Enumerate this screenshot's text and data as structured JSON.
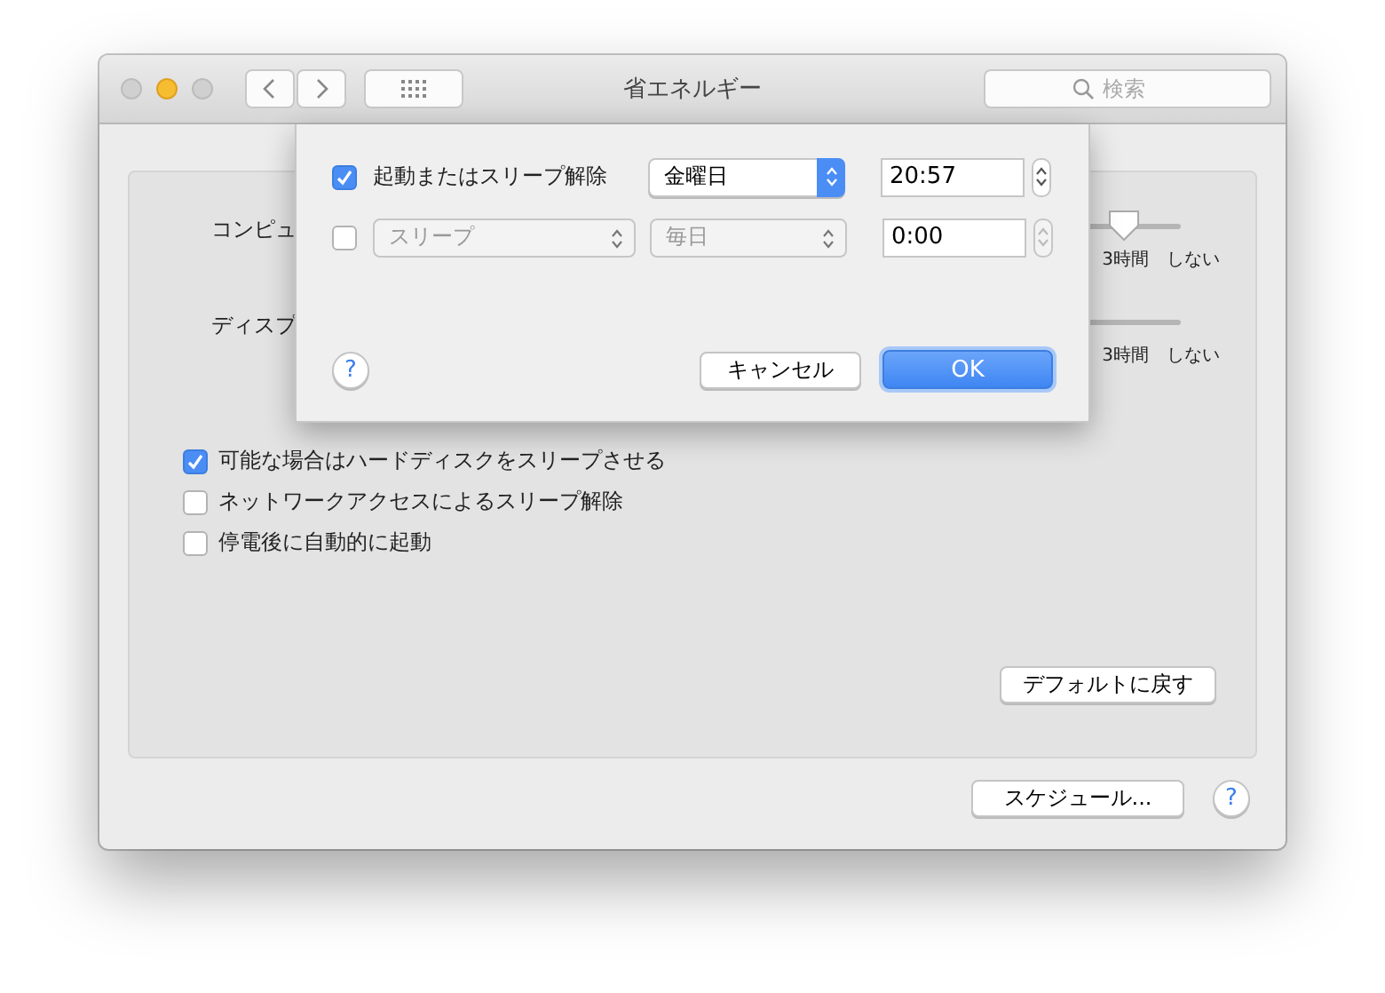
{
  "window": {
    "title": "省エネルギー",
    "search": {
      "placeholder": "検索"
    }
  },
  "settings": [
    {
      "label": "コンピュ",
      "level": 0.93,
      "ticks": [
        "3時間",
        "しない"
      ]
    },
    {
      "label": "ディスプ",
      "ticks": [
        "3時間",
        "しない"
      ]
    }
  ],
  "options": [
    {
      "label": "可能な場合はハードディスクをスリープさせる",
      "checked": true
    },
    {
      "label": "ネットワークアクセスによるスリープ解除",
      "checked": false
    },
    {
      "label": "停電後に自動的に起動",
      "checked": false
    }
  ],
  "buttons": {
    "restore": "デフォルトに戻す",
    "schedule": "スケジュール...",
    "help": "?"
  },
  "schedule_sheet": {
    "rows": [
      {
        "kind": "label",
        "checked": true,
        "event": "起動またはスリープ解除",
        "day": "金曜日",
        "time": "20:57",
        "disabled": false
      },
      {
        "kind": "popup",
        "checked": false,
        "event": "スリープ",
        "day": "毎日",
        "time": "0:00",
        "disabled": true
      }
    ],
    "help": "?",
    "cancel": "キャンセル",
    "ok": "OK"
  }
}
